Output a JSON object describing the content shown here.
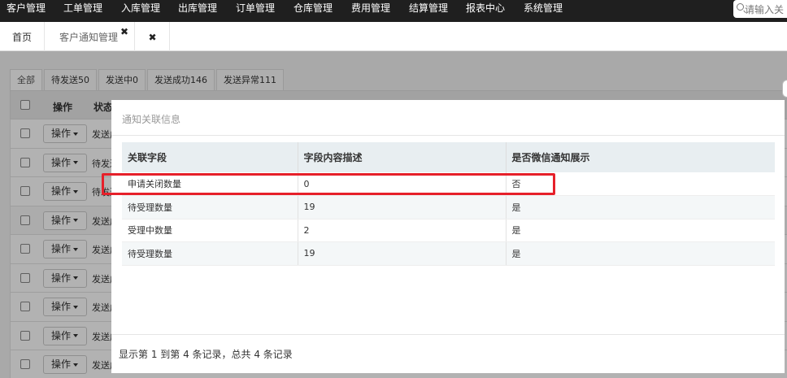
{
  "topnav": {
    "items": [
      "客户管理",
      "工单管理",
      "入库管理",
      "出库管理",
      "订单管理",
      "仓库管理",
      "费用管理",
      "结算管理",
      "报表中心",
      "系统管理"
    ],
    "search_placeholder": "请输入关"
  },
  "tabs": {
    "home": "首页",
    "active": "客户通知管理",
    "active_close": "✖",
    "close_all": "✖"
  },
  "background": {
    "status_tabs": [
      "全部",
      "待发送50",
      "发送中0",
      "发送成功146",
      "发送异常111"
    ],
    "table_headers": {
      "op": "操作",
      "status": "状态"
    },
    "row_op_label": "操作",
    "rows": [
      "发送成",
      "待发送",
      "待发送",
      "发送成",
      "发送成",
      "发送成",
      "发送成",
      "发送成",
      "发送成"
    ]
  },
  "modal": {
    "title": "通知关联信息",
    "columns": [
      "关联字段",
      "字段内容描述",
      "是否微信通知展示"
    ],
    "rows": [
      [
        "申请关闭数量",
        "0",
        "否"
      ],
      [
        "待受理数量",
        "19",
        "是"
      ],
      [
        "受理中数量",
        "2",
        "是"
      ],
      [
        "待受理数量",
        "19",
        "是"
      ]
    ],
    "footer": "显示第 1 到第 4 条记录，总共 4 条记录"
  },
  "colors": {
    "highlight": "#e6202a",
    "nav_bg": "#1f1f1f"
  }
}
